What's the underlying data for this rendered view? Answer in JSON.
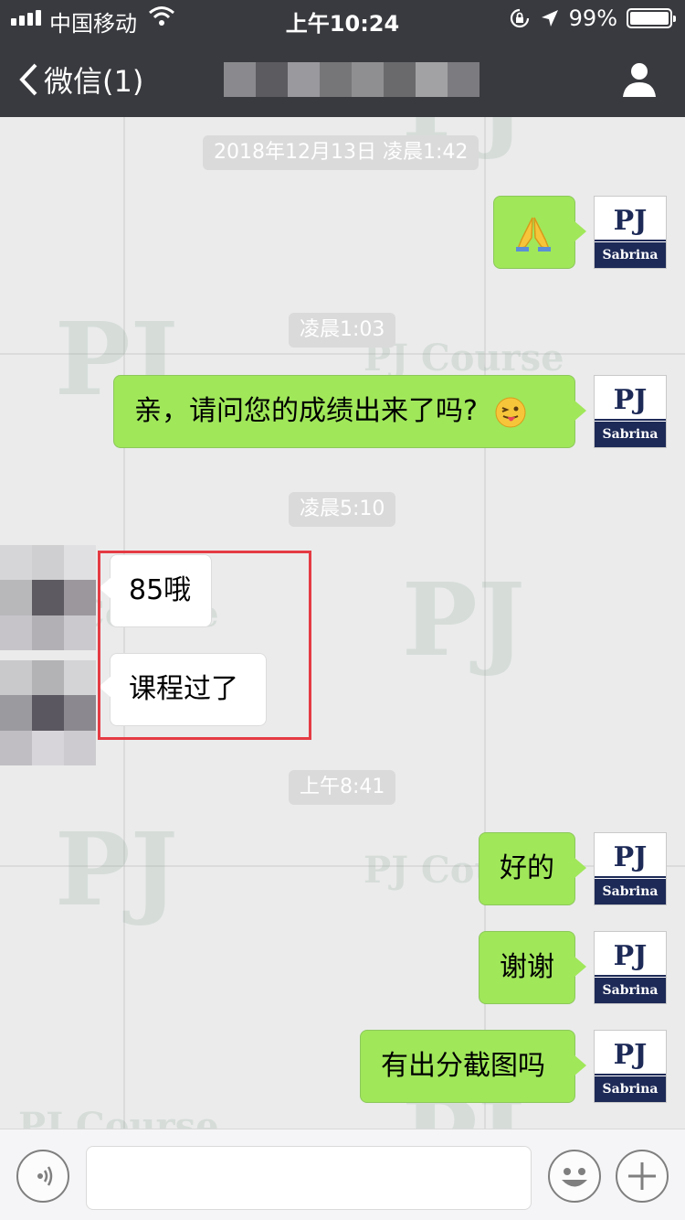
{
  "status_bar": {
    "carrier": "中国移动",
    "time": "上午10:24",
    "battery": "99%"
  },
  "nav": {
    "back_label": "微信(1)"
  },
  "avatar": {
    "logo_text": "PJ",
    "name": "Sabrina"
  },
  "watermark": {
    "big": "PJ",
    "small": "PJ Course"
  },
  "chat": {
    "times": [
      "2018年12月13日 凌晨1:42",
      "凌晨1:03",
      "凌晨5:10",
      "上午8:41"
    ],
    "messages": {
      "m2": "亲，请问您的成绩出来了吗?",
      "m3": "85哦",
      "m4": "课程过了",
      "m5": "好的",
      "m6": "谢谢",
      "m7": "有出分截图吗"
    }
  },
  "colors": {
    "nav_bg": "#393a3f",
    "chat_bg": "#ebebeb",
    "my_bubble": "#a0e75a",
    "highlight": "#e43b43"
  },
  "icons": [
    "signal-icon",
    "wifi-icon",
    "orientation-lock-icon",
    "location-icon",
    "battery-icon",
    "chevron-left-icon",
    "profile-icon",
    "folded-hands-emoji",
    "winking-tongue-emoji",
    "voice-icon",
    "emoji-icon",
    "plus-icon"
  ]
}
